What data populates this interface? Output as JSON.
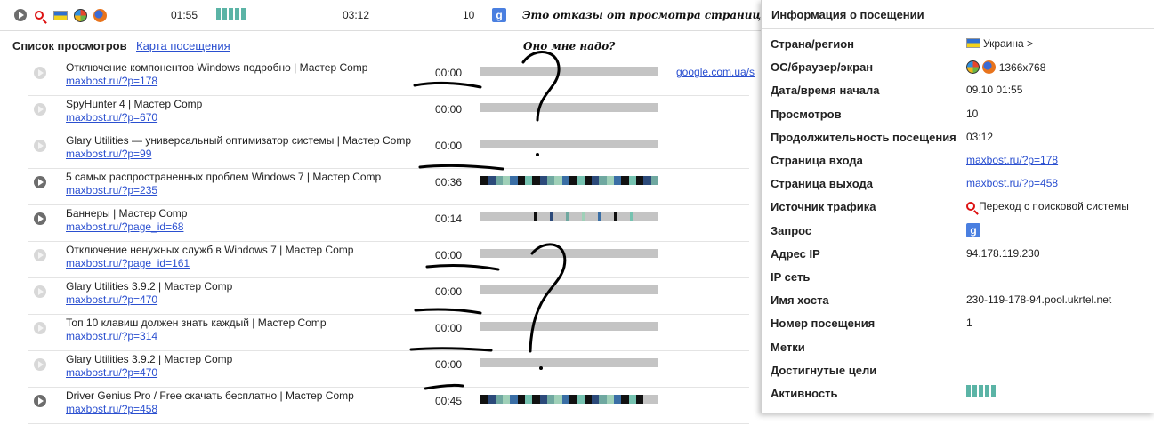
{
  "topbar": {
    "time_start": "01:55",
    "duration": "03:12",
    "views": "10",
    "caption": "Это отказы от просмотра страниц.",
    "question": "Оно мне надо?",
    "google_letter": "g",
    "icons": [
      "play-icon",
      "search-icon",
      "flag-ua-icon",
      "windows-icon",
      "firefox-icon",
      "google-icon"
    ]
  },
  "list": {
    "title": "Список просмотров",
    "map_link": "Карта посещения",
    "referrer": "google.com.ua/s",
    "rows": [
      {
        "title": "Отключение компонентов Windows подробно | Мастер Comp",
        "url": "maxbost.ru/?p=178",
        "duration": "00:00",
        "active": false,
        "activity": 0
      },
      {
        "title": "SpyHunter 4 | Мастер Comp",
        "url": "maxbost.ru/?p=670",
        "duration": "00:00",
        "active": false,
        "activity": 0
      },
      {
        "title": "Glary Utilities — универсальный оптимизатор системы | Мастер Comp",
        "url": "maxbost.ru/?p=99",
        "duration": "00:00",
        "active": false,
        "activity": 0
      },
      {
        "title": "5 самых распространенных проблем Windows 7 | Мастер Comp",
        "url": "maxbost.ru/?p=235",
        "duration": "00:36",
        "active": true,
        "activity": 1
      },
      {
        "title": "Баннеры | Мастер Comp",
        "url": "maxbost.ru/?page_id=68",
        "duration": "00:14",
        "active": true,
        "activity": 0.3
      },
      {
        "title": "Отключение ненужных служб в Windows 7 | Мастер Comp",
        "url": "maxbost.ru/?page_id=161",
        "duration": "00:00",
        "active": false,
        "activity": 0
      },
      {
        "title": "Glary Utilities 3.9.2 | Мастер Comp",
        "url": "maxbost.ru/?p=470",
        "duration": "00:00",
        "active": false,
        "activity": 0
      },
      {
        "title": "Топ 10 клавиш должен знать каждый | Мастер Comp",
        "url": "maxbost.ru/?p=314",
        "duration": "00:00",
        "active": false,
        "activity": 0
      },
      {
        "title": "Glary Utilities 3.9.2 | Мастер Comp",
        "url": "maxbost.ru/?p=470",
        "duration": "00:00",
        "active": false,
        "activity": 0
      },
      {
        "title": "Driver Genius Pro / Free скачать бесплатно | Мастер Comp",
        "url": "maxbost.ru/?p=458",
        "duration": "00:45",
        "active": true,
        "activity": 0.9
      }
    ]
  },
  "panel": {
    "title": "Информация о посещении",
    "rows": [
      {
        "label": "Страна/регион",
        "value": "Украина >"
      },
      {
        "label": "ОС/браузер/экран",
        "value": "1366x768"
      },
      {
        "label": "Дата/время начала",
        "value": "09.10 01:55"
      },
      {
        "label": "Просмотров",
        "value": "10"
      },
      {
        "label": "Продолжительность посещения",
        "value": "03:12"
      },
      {
        "label": "Страница входа",
        "value": "maxbost.ru/?p=178"
      },
      {
        "label": "Страница выхода",
        "value": "maxbost.ru/?p=458"
      },
      {
        "label": "Источник трафика",
        "value": "Переход с поисковой системы"
      },
      {
        "label": "Запрос",
        "value": ""
      },
      {
        "label": "Адрес IP",
        "value": "94.178.119.230"
      },
      {
        "label": "IP сеть",
        "value": ""
      },
      {
        "label": "Имя хоста",
        "value": "230-119-178-94.pool.ukrtel.net"
      },
      {
        "label": "Номер посещения",
        "value": "1"
      },
      {
        "label": "Метки",
        "value": ""
      },
      {
        "label": "Достигнутые цели",
        "value": ""
      },
      {
        "label": "Активность",
        "value": ""
      }
    ]
  },
  "colors": {
    "link": "#2a4fd0",
    "activity": "#5bb4a6",
    "bar": "#c4c4c4"
  }
}
